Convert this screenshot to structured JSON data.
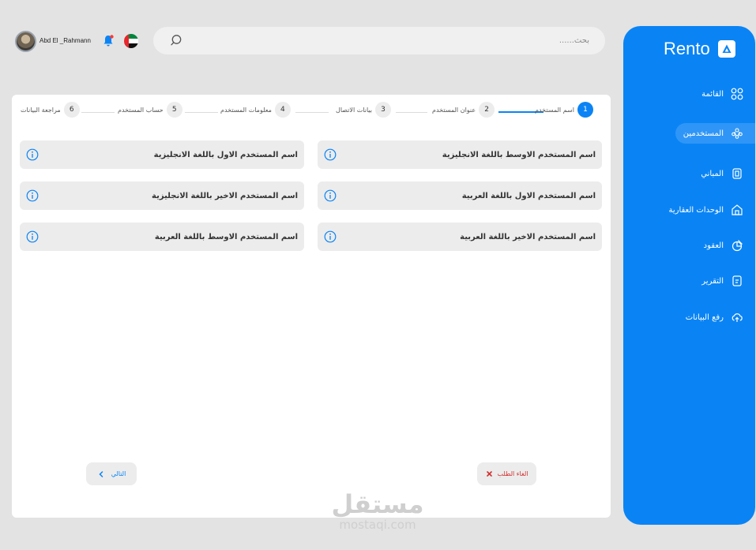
{
  "brand": {
    "name": "Rento",
    "logo_icon": "triangle-logo-icon"
  },
  "user": {
    "name": "Abd El _Rahmann"
  },
  "search": {
    "placeholder": "بحث......"
  },
  "sidebar": {
    "items": [
      {
        "label": "القائمة",
        "icon": "grid-icon"
      },
      {
        "label": "المستخدمين",
        "icon": "users-icon",
        "active": true
      },
      {
        "label": "المباني",
        "icon": "building-icon"
      },
      {
        "label": "الوحدات العقارية",
        "icon": "home-icon"
      },
      {
        "label": "العقود",
        "icon": "contract-icon"
      },
      {
        "label": "التقرير",
        "icon": "report-icon"
      },
      {
        "label": "رفع البيانات",
        "icon": "upload-cloud-icon"
      }
    ]
  },
  "steps": [
    {
      "num": "1",
      "label": "اسم المستخدم",
      "active": true
    },
    {
      "num": "2",
      "label": "عنوان المستخدم"
    },
    {
      "num": "3",
      "label": "بيانات الاتصال"
    },
    {
      "num": "4",
      "label": "معلومات المستخدم"
    },
    {
      "num": "5",
      "label": "حساب المستخدم"
    },
    {
      "num": "6",
      "label": "مراجعة البيانات"
    }
  ],
  "fields": {
    "right": [
      "اسم المستخدم الاوسط باللغة الانجليزية",
      "اسم المستخدم الاول باللغة العربية",
      "اسم المستخدم  الاخير باللغة العربية"
    ],
    "left": [
      "اسم المستخدم الاول باللغة الانجليزية",
      "اسم المستخدم  الاخير باللغة الانجليزية",
      "اسم المستخدم الاوسط باللغة العربية"
    ]
  },
  "buttons": {
    "next": "التالي",
    "cancel": "الغاء الطلب"
  },
  "watermark": {
    "arabic": "مستقل",
    "english": "mostaqi.com"
  },
  "colors": {
    "accent": "#0a84f5",
    "danger": "#d32f2f",
    "background": "#e3e3e3"
  }
}
